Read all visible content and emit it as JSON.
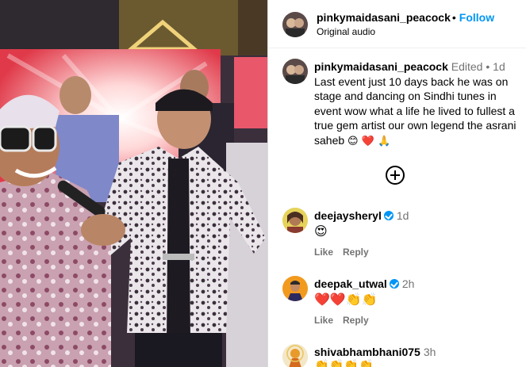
{
  "post": {
    "author": "pinkymaidasani_peacock",
    "follow_label": "Follow",
    "separator": "•",
    "audio": "Original audio"
  },
  "caption": {
    "author": "pinkymaidasani_peacock",
    "edited": "Edited",
    "time": "1d",
    "text": "Last event just 10 days back he was on stage and dancing on Sindhi tunes in event wow what a life he lived to fullest a true gem artist our own legend the asrani saheb",
    "emojis": "😊 ❤️ 🙏"
  },
  "comments": [
    {
      "user": "deejaysheryl",
      "verified": true,
      "time": "1d",
      "text": "😍",
      "like_label": "Like",
      "reply_label": "Reply"
    },
    {
      "user": "deepak_utwal",
      "verified": true,
      "time": "2h",
      "text": "❤️❤️👏👏",
      "like_label": "Like",
      "reply_label": "Reply"
    },
    {
      "user": "shivabhambhani075",
      "verified": false,
      "time": "3h",
      "text": "👏👏👏👏"
    }
  ],
  "colors": {
    "link_blue": "#0095f6",
    "muted": "#737373",
    "heart_red": "#ed4956"
  }
}
